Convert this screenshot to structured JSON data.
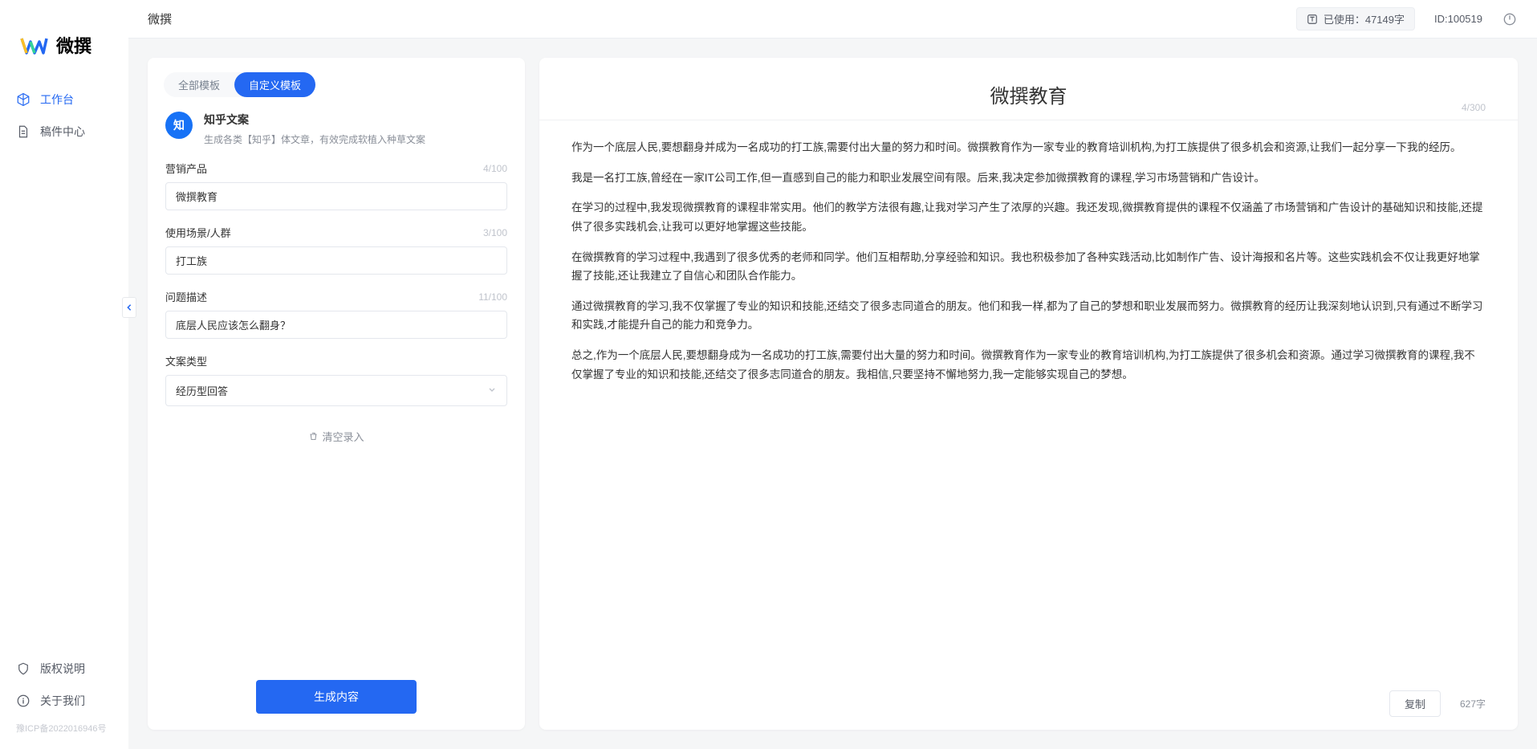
{
  "app": {
    "logo_text": "微撰",
    "topbar_title": "微撰"
  },
  "sidebar": {
    "nav": [
      {
        "label": "工作台",
        "icon": "cube",
        "active": true
      },
      {
        "label": "稿件中心",
        "icon": "doc",
        "active": false
      }
    ],
    "footer": [
      {
        "label": "版权说明",
        "icon": "shield"
      },
      {
        "label": "关于我们",
        "icon": "info"
      }
    ],
    "icp": "豫ICP备2022016946号"
  },
  "topbar": {
    "usage_prefix": "已使用：",
    "usage_value": "47149字",
    "id_label": "ID:100519"
  },
  "tabs": {
    "all": "全部模板",
    "custom": "自定义模板",
    "active": "custom"
  },
  "template": {
    "icon_text": "知",
    "title": "知乎文案",
    "desc": "生成各类【知乎】体文章，有效完成软植入种草文案"
  },
  "form": {
    "fields": [
      {
        "label": "营销产品",
        "value": "微撰教育",
        "count": "4/100",
        "type": "text"
      },
      {
        "label": "使用场景/人群",
        "value": "打工族",
        "count": "3/100",
        "type": "text"
      },
      {
        "label": "问题描述",
        "value": "底层人民应该怎么翻身？",
        "count": "11/100",
        "type": "text"
      },
      {
        "label": "文案类型",
        "value": "经历型回答",
        "count": "",
        "type": "select"
      }
    ],
    "clear_label": "清空录入",
    "generate_label": "生成内容"
  },
  "output": {
    "title": "微撰教育",
    "title_counter": "4/300",
    "paragraphs": [
      "作为一个底层人民,要想翻身并成为一名成功的打工族,需要付出大量的努力和时间。微撰教育作为一家专业的教育培训机构,为打工族提供了很多机会和资源,让我们一起分享一下我的经历。",
      "我是一名打工族,曾经在一家IT公司工作,但一直感到自己的能力和职业发展空间有限。后来,我决定参加微撰教育的课程,学习市场营销和广告设计。",
      "在学习的过程中,我发现微撰教育的课程非常实用。他们的教学方法很有趣,让我对学习产生了浓厚的兴趣。我还发现,微撰教育提供的课程不仅涵盖了市场营销和广告设计的基础知识和技能,还提供了很多实践机会,让我可以更好地掌握这些技能。",
      "在微撰教育的学习过程中,我遇到了很多优秀的老师和同学。他们互相帮助,分享经验和知识。我也积极参加了各种实践活动,比如制作广告、设计海报和名片等。这些实践机会不仅让我更好地掌握了技能,还让我建立了自信心和团队合作能力。",
      "通过微撰教育的学习,我不仅掌握了专业的知识和技能,还结交了很多志同道合的朋友。他们和我一样,都为了自己的梦想和职业发展而努力。微撰教育的经历让我深刻地认识到,只有通过不断学习和实践,才能提升自己的能力和竞争力。",
      "总之,作为一个底层人民,要想翻身成为一名成功的打工族,需要付出大量的努力和时间。微撰教育作为一家专业的教育培训机构,为打工族提供了很多机会和资源。通过学习微撰教育的课程,我不仅掌握了专业的知识和技能,还结交了很多志同道合的朋友。我相信,只要坚持不懈地努力,我一定能够实现自己的梦想。"
    ],
    "copy_label": "复制",
    "char_count": "627字"
  }
}
